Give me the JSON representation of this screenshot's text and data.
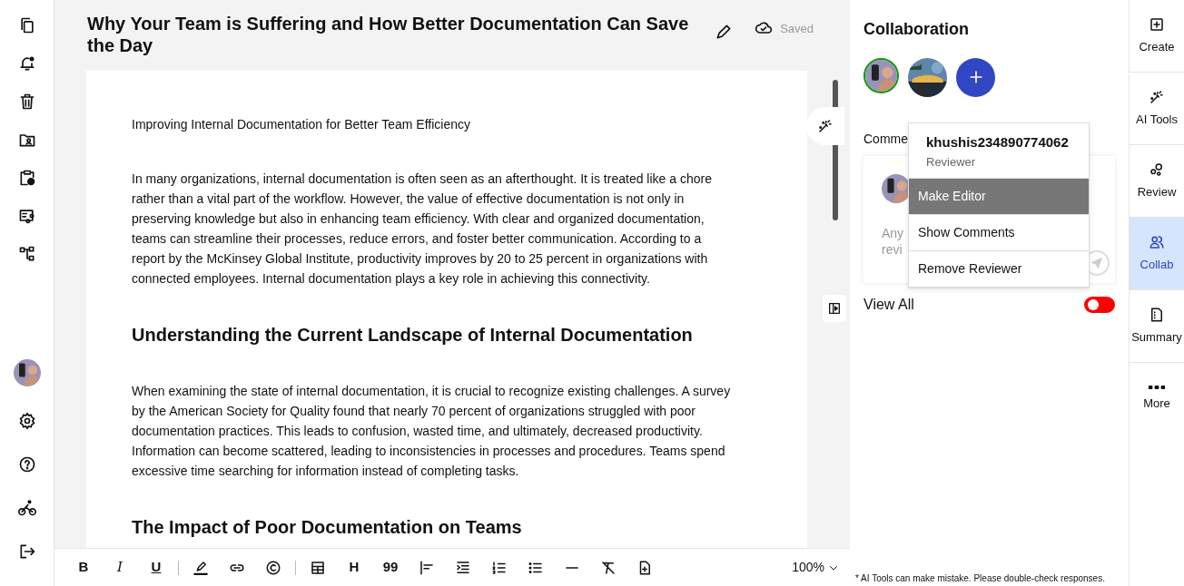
{
  "document": {
    "title": "Why Your Team is Suffering and How Better Documentation Can Save the Day",
    "save_status": "Saved",
    "blocks": [
      {
        "kind": "paragraph",
        "text": "Improving Internal Documentation for Better Team Efficiency"
      },
      {
        "kind": "paragraph",
        "text": "In many organizations, internal documentation is often seen as an afterthought. It is treated like a chore rather than a vital part of the workflow. However, the value of effective documentation is not only in preserving knowledge but also in enhancing team efficiency. With clear and organized documentation, teams can streamline their processes, reduce errors, and foster better communication. According to a report by the McKinsey Global Institute, productivity improves by 20 to 25 percent in organizations with connected employees. Internal documentation plays a key role in achieving this connectivity."
      },
      {
        "kind": "heading",
        "text": "Understanding the Current Landscape of Internal Documentation"
      },
      {
        "kind": "paragraph",
        "text": "When examining the state of internal documentation, it is crucial to recognize existing challenges. A survey by the American Society for Quality found that nearly 70 percent of organizations struggled with poor documentation practices. This leads to confusion, wasted time, and ultimately, decreased productivity. Information can become scattered, leading to inconsistencies in processes and procedures. Teams spend excessive time searching for information instead of completing tasks."
      },
      {
        "kind": "heading",
        "text": "The Impact of Poor Documentation on Teams"
      }
    ]
  },
  "toolbar": {
    "items": [
      {
        "kind": "text",
        "label": "B"
      },
      {
        "kind": "text",
        "label": "I"
      },
      {
        "kind": "text",
        "label": "U"
      },
      {
        "kind": "separator"
      },
      {
        "kind": "icon"
      },
      {
        "kind": "icon"
      },
      {
        "kind": "icon"
      },
      {
        "kind": "separator"
      },
      {
        "kind": "icon"
      },
      {
        "kind": "text",
        "label": "H"
      },
      {
        "kind": "text",
        "label": "99"
      },
      {
        "kind": "icon"
      },
      {
        "kind": "icon"
      },
      {
        "kind": "icon"
      },
      {
        "kind": "icon"
      },
      {
        "kind": "icon"
      },
      {
        "kind": "icon"
      },
      {
        "kind": "icon"
      }
    ],
    "zoom": "100%"
  },
  "collaboration": {
    "title": "Collaboration",
    "collaborators": [
      {
        "kind": "avatar",
        "active": true
      },
      {
        "kind": "picture",
        "active": false
      }
    ],
    "comments_label": "Comme",
    "comment_placeholder_lines": [
      "Any",
      "revi"
    ],
    "menu": {
      "user": "khushis234890774062",
      "role": "Reviewer",
      "items": [
        {
          "label": "Make Editor",
          "selected": true
        },
        {
          "label": "Show Comments",
          "selected": false
        },
        {
          "label": "Remove Reviewer",
          "selected": false
        }
      ]
    },
    "view_all": {
      "label": "View All",
      "on": false
    },
    "disclaimer": "* AI Tools can make mistake. Please double-check responses."
  },
  "right_rail": [
    {
      "label": "Create",
      "selected": false
    },
    {
      "label": "AI Tools",
      "selected": false
    },
    {
      "label": "Review",
      "selected": false
    },
    {
      "label": "Collab",
      "selected": true
    },
    {
      "label": "Summary",
      "selected": false
    },
    {
      "label": "More",
      "selected": false
    }
  ]
}
